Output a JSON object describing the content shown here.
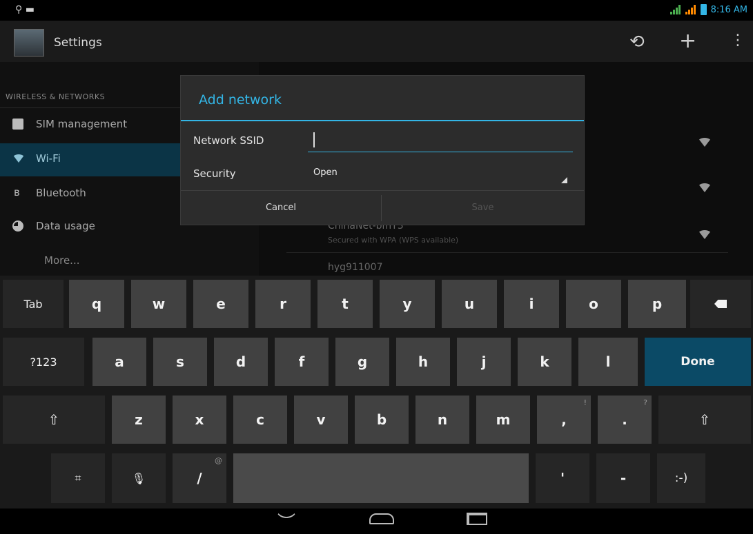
{
  "status_bar": {
    "time": "8:16 AM",
    "left_icons": [
      "usb-icon",
      "notification-icon"
    ]
  },
  "action_bar": {
    "title": "Settings",
    "actions": [
      "sync-icon",
      "add-icon",
      "overflow-icon"
    ]
  },
  "settings": {
    "section_header": "WIRELESS & NETWORKS",
    "items": [
      {
        "label": "SIM management",
        "icon": "sim-icon"
      },
      {
        "label": "Wi-Fi",
        "icon": "wifi-icon",
        "selected": true
      },
      {
        "label": "Bluetooth",
        "icon": "bluetooth-icon"
      },
      {
        "label": "Data usage",
        "icon": "data-usage-icon"
      },
      {
        "label": "More...",
        "icon": ""
      }
    ]
  },
  "networks": [
    {
      "name": "ChinaNet-bmY3",
      "status": "Secured with WPA (WPS available)"
    },
    {
      "name": "hyg911007",
      "status": ""
    }
  ],
  "dialog": {
    "title": "Add network",
    "ssid_label": "Network SSID",
    "ssid_value": "",
    "security_label": "Security",
    "security_value": "Open",
    "cancel": "Cancel",
    "save": "Save"
  },
  "keyboard": {
    "row1": [
      "Tab",
      "q",
      "w",
      "e",
      "r",
      "t",
      "y",
      "u",
      "i",
      "o",
      "p"
    ],
    "row2": [
      "?123",
      "a",
      "s",
      "d",
      "f",
      "g",
      "h",
      "j",
      "k",
      "l",
      "Done"
    ],
    "row3": [
      "z",
      "x",
      "c",
      "v",
      "b",
      "n",
      "m",
      ",",
      "."
    ],
    "row3_sup": {
      "comma": "!",
      "period": "?"
    },
    "row4": {
      "slash": "/",
      "slash_sup": "@",
      "apostrophe": "'",
      "dash": "-",
      "smiley": ":-)"
    }
  },
  "nav_bar": [
    "back-icon",
    "home-icon",
    "recents-icon"
  ],
  "colors": {
    "accent": "#33b5e5",
    "selected_bg": "#0b3446",
    "done_key": "#0b4a66"
  }
}
